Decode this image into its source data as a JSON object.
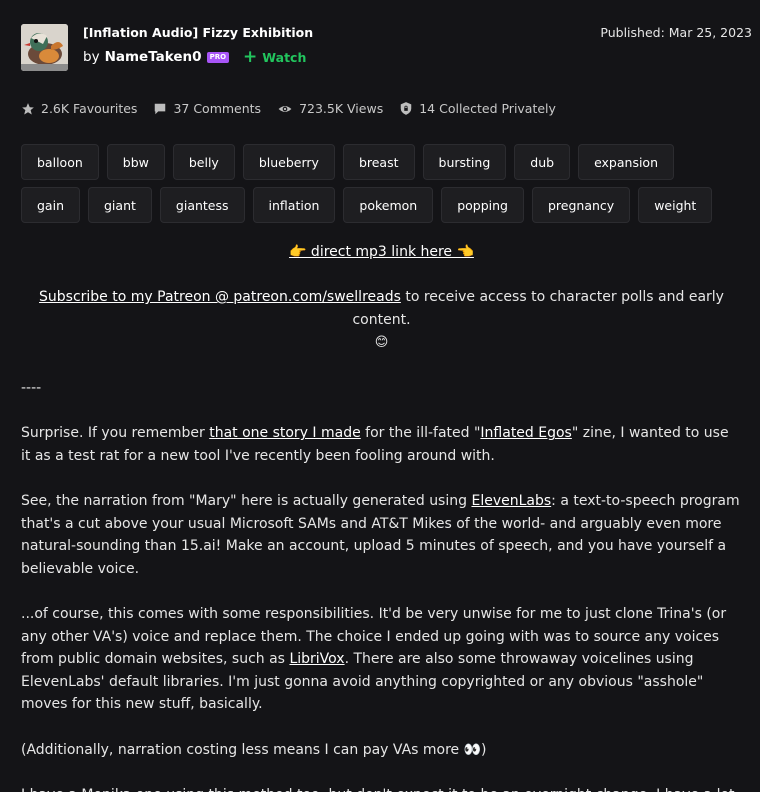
{
  "header": {
    "title": "[Inflation Audio] Fizzy Exhibition",
    "by_label": "by",
    "author": "NameTaken0",
    "pro_badge": "PRO",
    "watch_label": "Watch",
    "published": "Published: Mar 25, 2023"
  },
  "stats": {
    "favourites": "2.6K Favourites",
    "comments": "37 Comments",
    "views": "723.5K Views",
    "collected": "14 Collected Privately"
  },
  "tags": [
    "balloon",
    "bbw",
    "belly",
    "blueberry",
    "breast",
    "bursting",
    "dub",
    "expansion",
    "gain",
    "giant",
    "giantess",
    "inflation",
    "pokemon",
    "popping",
    "pregnancy",
    "weight"
  ],
  "description": {
    "mp3_link": "👉 direct mp3 link here 👈",
    "patreon_link": "Subscribe to my Patreon @ patreon.com/swellreads",
    "patreon_rest": " to receive access to character polls and early content.",
    "patreon_emoji": "😊",
    "divider": "----",
    "p1_a": "Surprise. If you remember ",
    "p1_link1": "that one story I made",
    "p1_b": " for the ill-fated \"",
    "p1_link2": "Inflated Egos",
    "p1_c": "\" zine, I wanted to use it as a test rat for a new tool I've recently been fooling around with.",
    "p2_a": "See, the narration from \"Mary\" here is actually generated using ",
    "p2_link": "ElevenLabs",
    "p2_b": ": a text-to-speech program that's a cut above your usual Microsoft SAMs and AT&T Mikes of the world- and arguably even more natural-sounding than 15.ai! Make an account, upload 5 minutes of speech, and you have yourself a believable voice.",
    "p3_a": "...of course, this comes with some responsibilities. It'd be very unwise for me to just clone Trina's (or any other VA's) voice and replace them. The choice I ended up going with was to source any voices from public domain websites, such as ",
    "p3_link": "LibriVox",
    "p3_b": ". There are also some throwaway voicelines using ElevenLabs' default libraries. I'm just gonna avoid anything copyrighted or any obvious \"asshole\" moves for this new stuff, basically.",
    "p4": "(Additionally, narration costing less means I can pay VAs more 👀)",
    "p5": "I have a Monika one using this method too, but don't expect it to be an overnight change. I have a lot of regular scripts still being worked on."
  }
}
